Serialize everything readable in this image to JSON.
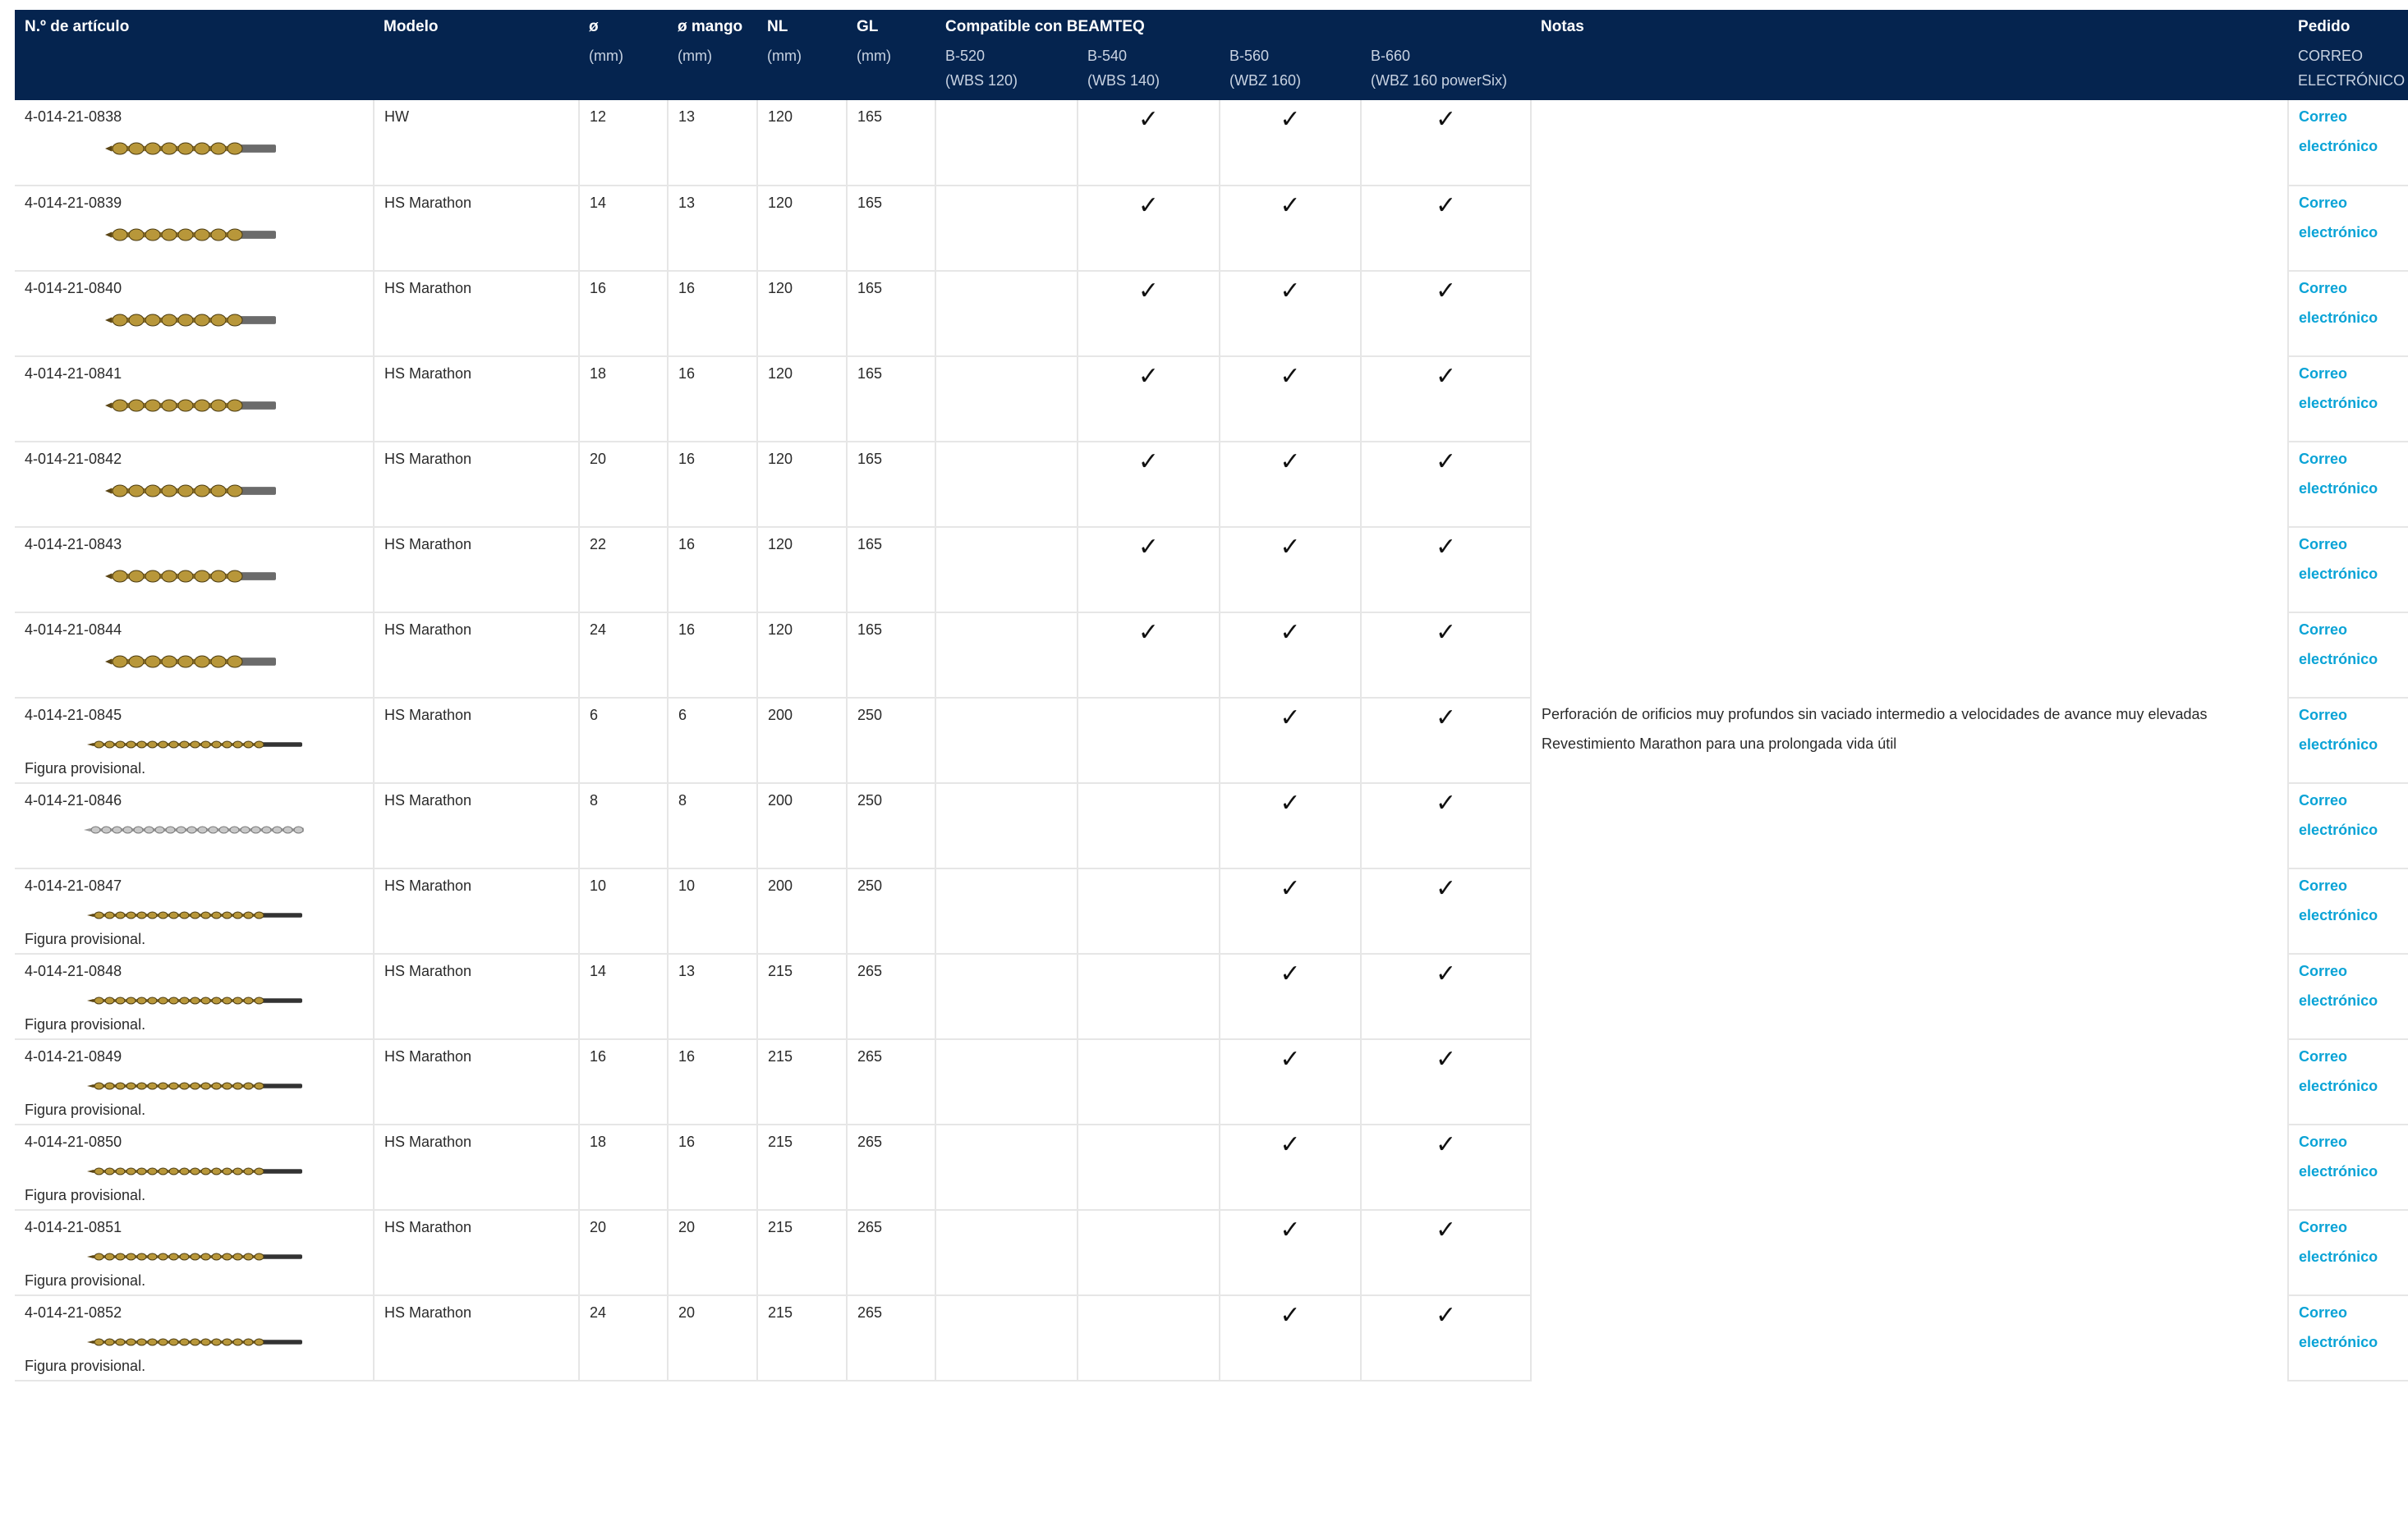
{
  "header": {
    "art": "N.º de artículo",
    "modelo": "Modelo",
    "diam": "ø",
    "diam_mango": "ø mango",
    "nl": "NL",
    "gl": "GL",
    "compat": "Compatible con BEAMTEQ",
    "notas": "Notas",
    "pedido": "Pedido",
    "unit": "(mm)",
    "b520": "B-520",
    "b540": "B-540",
    "b560": "B-560",
    "b660": "B-660",
    "wbs120": "(WBS 120)",
    "wbs140": "(WBS 140)",
    "wbz160": "(WBZ 160)",
    "wbz160ps": "(WBZ 160 powerSix)",
    "correo": "CORREO",
    "electronico": "ELECTRÓNICO"
  },
  "notes": {
    "line1": "Perforación de orificios muy profundos sin vaciado intermedio a velocidades de avance muy elevadas",
    "line2": "Revestimiento Marathon para una prolongada vida útil"
  },
  "check_symbol": "✓",
  "order_link": {
    "line1": "Correo",
    "line2": "electrónico"
  },
  "rows": [
    {
      "art": "4-014-21-0838",
      "modelo": "HW",
      "d": "12",
      "dm": "13",
      "nl": "120",
      "gl": "165",
      "b540": true,
      "b560": true,
      "b660": true,
      "prov": "",
      "drill": "short"
    },
    {
      "art": "4-014-21-0839",
      "modelo": "HS Marathon",
      "d": "14",
      "dm": "13",
      "nl": "120",
      "gl": "165",
      "b540": true,
      "b560": true,
      "b660": true,
      "prov": "",
      "drill": "short"
    },
    {
      "art": "4-014-21-0840",
      "modelo": "HS Marathon",
      "d": "16",
      "dm": "16",
      "nl": "120",
      "gl": "165",
      "b540": true,
      "b560": true,
      "b660": true,
      "prov": "",
      "drill": "short"
    },
    {
      "art": "4-014-21-0841",
      "modelo": "HS Marathon",
      "d": "18",
      "dm": "16",
      "nl": "120",
      "gl": "165",
      "b540": true,
      "b560": true,
      "b660": true,
      "prov": "",
      "drill": "short"
    },
    {
      "art": "4-014-21-0842",
      "modelo": "HS Marathon",
      "d": "20",
      "dm": "16",
      "nl": "120",
      "gl": "165",
      "b540": true,
      "b560": true,
      "b660": true,
      "prov": "",
      "drill": "short"
    },
    {
      "art": "4-014-21-0843",
      "modelo": "HS Marathon",
      "d": "22",
      "dm": "16",
      "nl": "120",
      "gl": "165",
      "b540": true,
      "b560": true,
      "b660": true,
      "prov": "",
      "drill": "short"
    },
    {
      "art": "4-014-21-0844",
      "modelo": "HS Marathon",
      "d": "24",
      "dm": "16",
      "nl": "120",
      "gl": "165",
      "b540": true,
      "b560": true,
      "b660": true,
      "prov": "",
      "drill": "short"
    },
    {
      "art": "4-014-21-0845",
      "modelo": "HS Marathon",
      "d": "6",
      "dm": "6",
      "nl": "200",
      "gl": "250",
      "b540": false,
      "b560": true,
      "b660": true,
      "prov": "Figura provisional.",
      "drill": "long"
    },
    {
      "art": "4-014-21-0846",
      "modelo": "HS Marathon",
      "d": "8",
      "dm": "8",
      "nl": "200",
      "gl": "250",
      "b540": false,
      "b560": true,
      "b660": true,
      "prov": "",
      "drill": "silver"
    },
    {
      "art": "4-014-21-0847",
      "modelo": "HS Marathon",
      "d": "10",
      "dm": "10",
      "nl": "200",
      "gl": "250",
      "b540": false,
      "b560": true,
      "b660": true,
      "prov": "Figura provisional.",
      "drill": "long"
    },
    {
      "art": "4-014-21-0848",
      "modelo": "HS Marathon",
      "d": "14",
      "dm": "13",
      "nl": "215",
      "gl": "265",
      "b540": false,
      "b560": true,
      "b660": true,
      "prov": "Figura provisional.",
      "drill": "long"
    },
    {
      "art": "4-014-21-0849",
      "modelo": "HS Marathon",
      "d": "16",
      "dm": "16",
      "nl": "215",
      "gl": "265",
      "b540": false,
      "b560": true,
      "b660": true,
      "prov": "Figura provisional.",
      "drill": "long"
    },
    {
      "art": "4-014-21-0850",
      "modelo": "HS Marathon",
      "d": "18",
      "dm": "16",
      "nl": "215",
      "gl": "265",
      "b540": false,
      "b560": true,
      "b660": true,
      "prov": "Figura provisional.",
      "drill": "long"
    },
    {
      "art": "4-014-21-0851",
      "modelo": "HS Marathon",
      "d": "20",
      "dm": "20",
      "nl": "215",
      "gl": "265",
      "b540": false,
      "b560": true,
      "b660": true,
      "prov": "Figura provisional.",
      "drill": "long"
    },
    {
      "art": "4-014-21-0852",
      "modelo": "HS Marathon",
      "d": "24",
      "dm": "20",
      "nl": "215",
      "gl": "265",
      "b540": false,
      "b560": true,
      "b660": true,
      "prov": "Figura provisional.",
      "drill": "long"
    }
  ]
}
